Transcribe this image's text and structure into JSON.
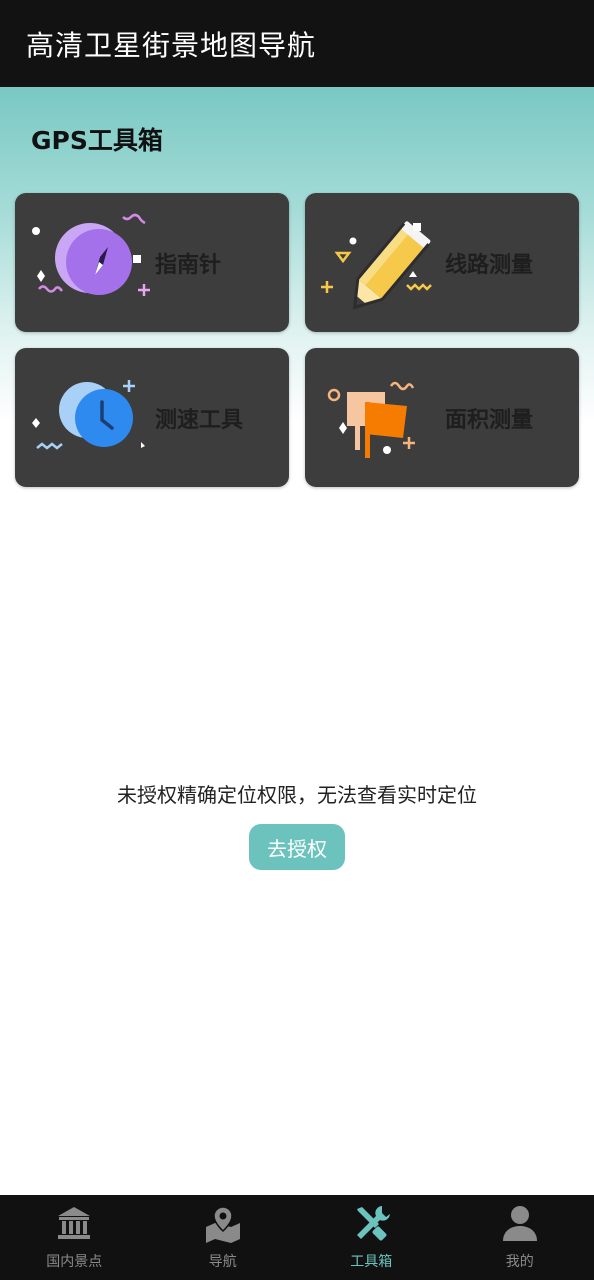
{
  "app": {
    "title": "高清卫星街景地图导航"
  },
  "section": {
    "title": "GPS工具箱"
  },
  "tools": [
    {
      "label": "指南针",
      "icon": "compass-icon"
    },
    {
      "label": "线路测量",
      "icon": "pencil-icon"
    },
    {
      "label": "测速工具",
      "icon": "clock-icon"
    },
    {
      "label": "面积测量",
      "icon": "flag-icon"
    }
  ],
  "permission": {
    "message": "未授权精确定位权限，无法查看实时定位",
    "button_label": "去授权"
  },
  "tabbar": {
    "items": [
      {
        "label": "国内景点",
        "icon": "landmark-icon"
      },
      {
        "label": "导航",
        "icon": "map-pin-icon"
      },
      {
        "label": "工具箱",
        "icon": "tools-icon"
      },
      {
        "label": "我的",
        "icon": "person-icon"
      }
    ],
    "active_index": 2,
    "active_color": "#6cc3bd"
  },
  "colors": {
    "appbar": "#121212",
    "card": "#3d3d3d",
    "accent": "#6cc3bd"
  }
}
